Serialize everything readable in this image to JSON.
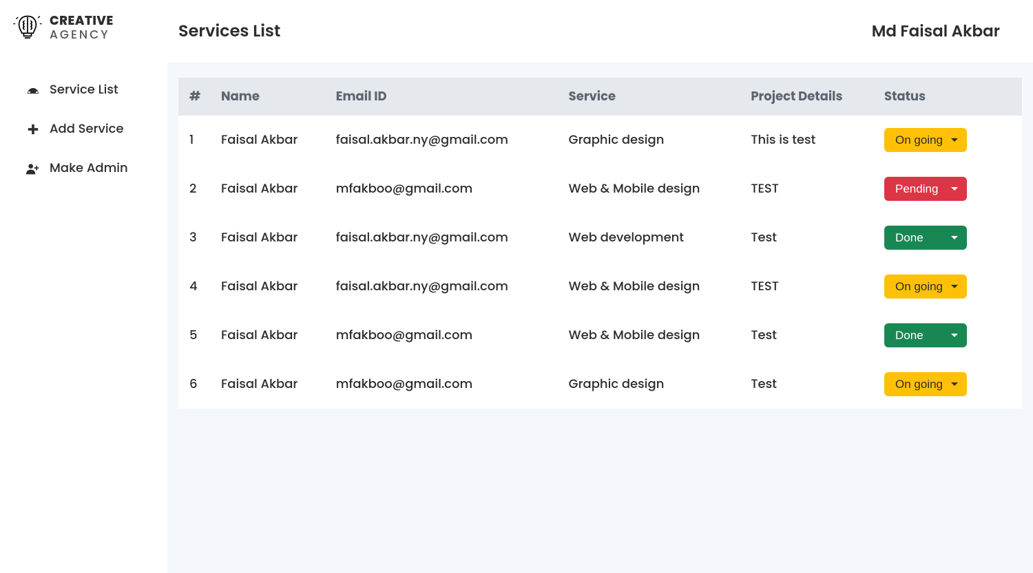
{
  "logo": {
    "line1": "CREATIVE",
    "line2": "AGENCY"
  },
  "sidebar": {
    "items": [
      {
        "label": "Service List",
        "icon": "speedometer-icon"
      },
      {
        "label": "Add Service",
        "icon": "plus-icon"
      },
      {
        "label": "Make Admin",
        "icon": "user-plus-icon"
      }
    ]
  },
  "header": {
    "title": "Services List",
    "user": "Md Faisal Akbar"
  },
  "table": {
    "columns": [
      "#",
      "Name",
      "Email ID",
      "Service",
      "Project Details",
      "Status"
    ],
    "rows": [
      {
        "idx": "1",
        "name": "Faisal Akbar",
        "email": "faisal.akbar.ny@gmail.com",
        "service": "Graphic design",
        "details": "This is test",
        "status": "On going",
        "statusClass": "status-ongoing"
      },
      {
        "idx": "2",
        "name": "Faisal Akbar",
        "email": "mfakboo@gmail.com",
        "service": "Web & Mobile design",
        "details": "TEST",
        "status": "Pending",
        "statusClass": "status-pending"
      },
      {
        "idx": "3",
        "name": "Faisal Akbar",
        "email": "faisal.akbar.ny@gmail.com",
        "service": "Web development",
        "details": "Test",
        "status": "Done",
        "statusClass": "status-done"
      },
      {
        "idx": "4",
        "name": "Faisal Akbar",
        "email": "faisal.akbar.ny@gmail.com",
        "service": "Web & Mobile design",
        "details": "TEST",
        "status": "On going",
        "statusClass": "status-ongoing"
      },
      {
        "idx": "5",
        "name": "Faisal Akbar",
        "email": "mfakboo@gmail.com",
        "service": "Web & Mobile design",
        "details": "Test",
        "status": "Done",
        "statusClass": "status-done"
      },
      {
        "idx": "6",
        "name": "Faisal Akbar",
        "email": "mfakboo@gmail.com",
        "service": "Graphic design",
        "details": "Test",
        "status": "On going",
        "statusClass": "status-ongoing"
      }
    ]
  },
  "statusOptions": [
    "On going",
    "Pending",
    "Done"
  ]
}
